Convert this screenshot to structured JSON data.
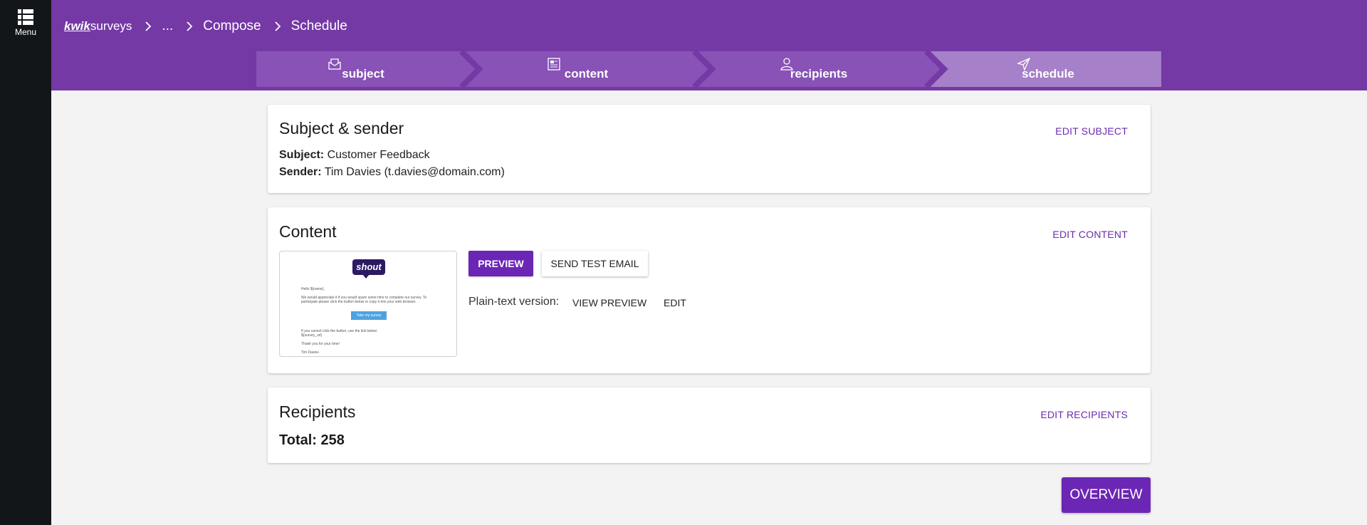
{
  "nav": {
    "menu_label": "Menu"
  },
  "breadcrumb": {
    "logo_bold": "kwik",
    "logo_rest": "surveys",
    "ellipsis": "...",
    "compose": "Compose",
    "current": "Schedule"
  },
  "stepper": {
    "steps": [
      {
        "label": "subject",
        "icon": "envelope-icon"
      },
      {
        "label": "content",
        "icon": "document-icon"
      },
      {
        "label": "recipients",
        "icon": "user-icon"
      },
      {
        "label": "schedule",
        "icon": "send-icon",
        "active": true
      }
    ]
  },
  "subject_card": {
    "title": "Subject & sender",
    "edit_label": "EDIT SUBJECT",
    "subject_key": "Subject:",
    "subject_value": "Customer Feedback",
    "sender_key": "Sender:",
    "sender_value": "Tim Davies (t.davies@domain.com)"
  },
  "content_card": {
    "title": "Content",
    "edit_label": "EDIT CONTENT",
    "preview_label": "PREVIEW",
    "send_test_label": "SEND TEST EMAIL",
    "plain_text_label": "Plain-text version:",
    "view_preview_label": "VIEW PREVIEW",
    "edit_plain_label": "EDIT",
    "thumbnail": {
      "logo": "shout",
      "greeting": "Hello ${name},",
      "body1": "We would appreciate it if you would spare some time to complete our survey. To",
      "body2": "participate please click the button below or copy it into your web browser.",
      "button": "Take my survey",
      "fallback1": "If you cannot click the button, use the link below:",
      "fallback2": "${survey_url}",
      "thanks": "Thank you for your time!",
      "signature": "Tim Davies"
    }
  },
  "recipients_card": {
    "title": "Recipients",
    "edit_label": "EDIT RECIPIENTS",
    "total": "Total: 258"
  },
  "overview_label": "OVERVIEW",
  "colors": {
    "header": "#7539a6",
    "rail": "#121619",
    "primary": "#6c26b5",
    "step_bg": "#8852b6",
    "step_active": "#a680c8"
  }
}
